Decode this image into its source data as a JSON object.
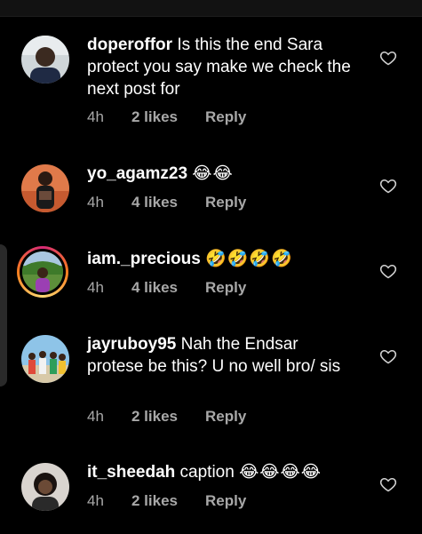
{
  "comments": [
    {
      "username": "doperoffor",
      "text": " Is this the end Sara protect you say make we check the next post for",
      "emojis": "",
      "time": "4h",
      "likes": "2 likes",
      "reply_label": "Reply",
      "avatar_icon": "person-avatar-icon"
    },
    {
      "username": "yo_agamz23",
      "text": " ",
      "emojis": "😂😂",
      "time": "4h",
      "likes": "4 likes",
      "reply_label": "Reply",
      "avatar_icon": "person-avatar-icon"
    },
    {
      "username": "iam._precious",
      "text": " ",
      "emojis": "🤣🤣🤣🤣",
      "time": "4h",
      "likes": "4 likes",
      "reply_label": "Reply",
      "avatar_icon": "person-avatar-icon"
    },
    {
      "username": "jayruboy95",
      "text": " Nah the Endsar protese be this? U no well bro/ sis",
      "emojis": "",
      "time": "4h",
      "likes": "2 likes",
      "reply_label": "Reply",
      "avatar_icon": "group-avatar-icon"
    },
    {
      "username": "it_sheedah",
      "text": " caption ",
      "emojis": "😂😂😂😂",
      "time": "4h",
      "likes": "2 likes",
      "reply_label": "Reply",
      "avatar_icon": "person-avatar-icon"
    }
  ],
  "colors": {
    "background": "#000000",
    "text": "#ffffff",
    "meta": "#a8a8a8"
  }
}
